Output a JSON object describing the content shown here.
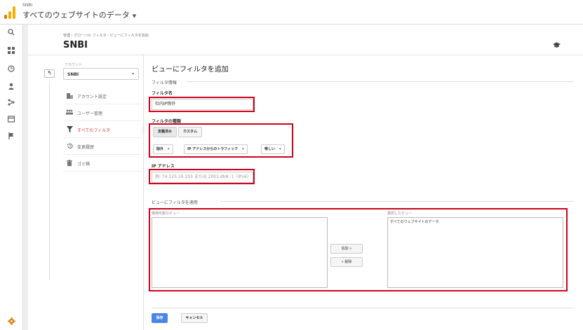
{
  "header": {
    "account_small": "SNBI",
    "property_title": "すべてのウェブサイトのデータ",
    "caret": "▼"
  },
  "rail": {
    "icons": [
      "search-icon",
      "dashboard-icon",
      "clock-icon",
      "person-icon",
      "acquisition-icon",
      "behavior-icon",
      "flag-icon",
      "admin-gear-icon"
    ]
  },
  "page": {
    "breadcrumb": "管理 › グローバル フィルタ › ビューにフィルタを追加",
    "title": "SNBI"
  },
  "nav": {
    "back_label": "↰",
    "account_label": "アカウント",
    "account_value": "SNBI",
    "items": [
      {
        "label": "アカウント設定",
        "icon": "building-icon"
      },
      {
        "label": "ユーザー管理",
        "icon": "users-icon"
      },
      {
        "label": "すべてのフィルタ",
        "icon": "filter-icon"
      },
      {
        "label": "変更履歴",
        "icon": "history-icon"
      },
      {
        "label": "ゴミ箱",
        "icon": "trash-icon"
      }
    ]
  },
  "form": {
    "title": "ビューにフィルタを追加",
    "filter_info_header": "フィルタ情報",
    "filter_name_label": "フィルタ名",
    "filter_name_value": "社内IP除外",
    "filter_type_label": "フィルタの種類",
    "type_predefined": "定義済み",
    "type_custom": "カスタム",
    "select_exclude": "除外",
    "select_source": "IP アドレスからのトラフィック",
    "select_equals": "等しい",
    "ip_label": "IP アドレス",
    "ip_placeholder": "例: 74.125.19.103 または 2001:db8::1（IPv6）",
    "apply_header": "ビューにフィルタを適用",
    "available_views_label": "使用可能なビュー",
    "selected_views_label": "選択したビュー",
    "selected_views": [
      "すべてのウェブサイトのデータ"
    ],
    "add_button": "追加 »",
    "remove_button": "« 削除",
    "save_button": "保存",
    "cancel_button": "キャンセル"
  },
  "colors": {
    "highlight": "#d0021b",
    "active_nav": "#e53935",
    "primary": "#4a86e8",
    "logo_orange": "#f9ab00"
  }
}
